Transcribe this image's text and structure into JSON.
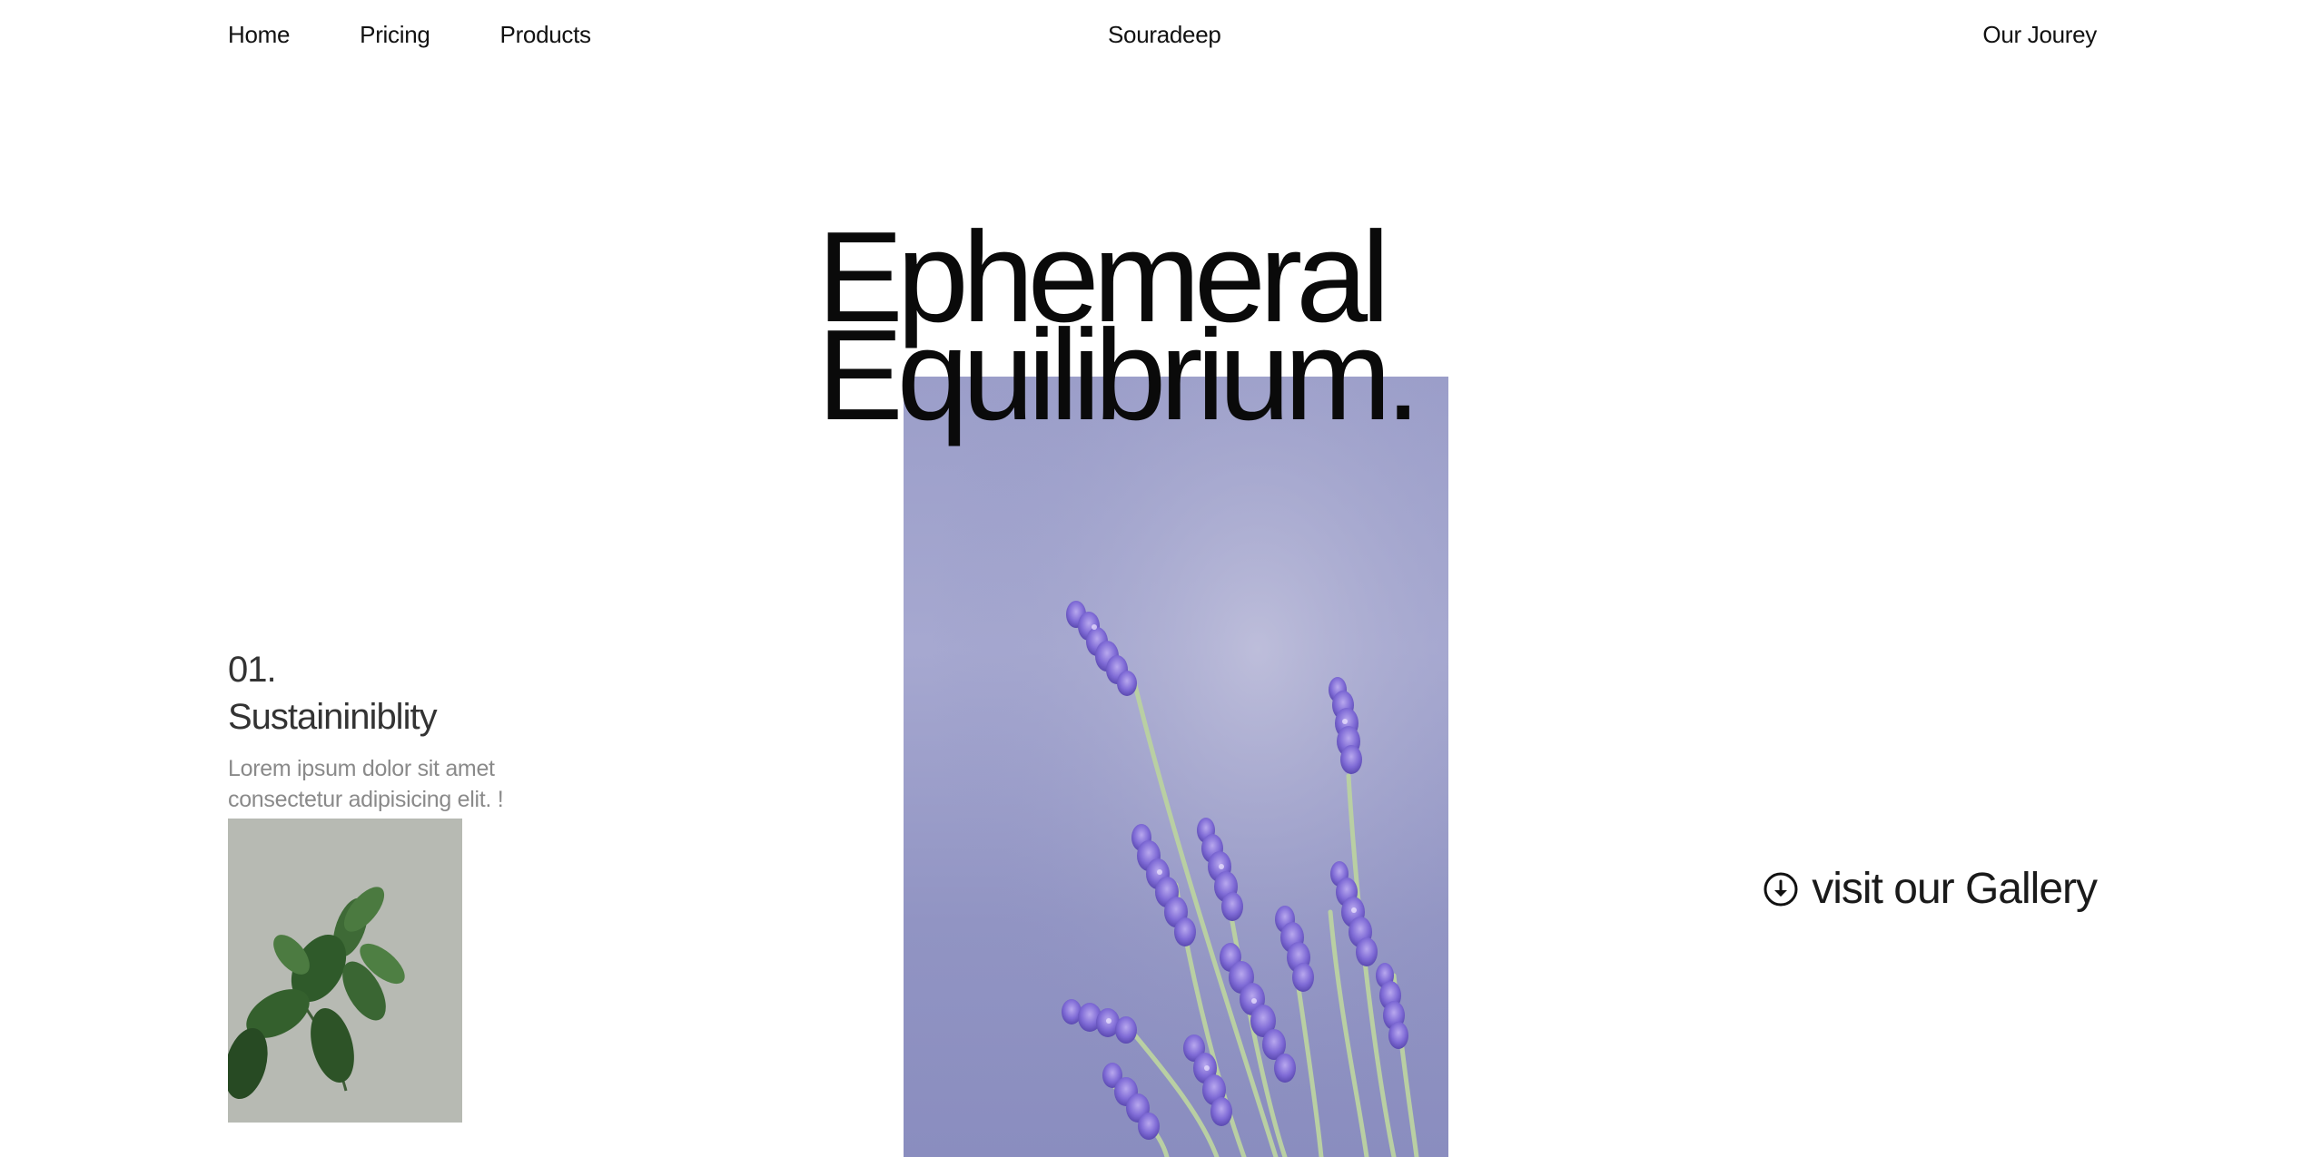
{
  "nav": {
    "items": [
      {
        "label": "Home"
      },
      {
        "label": "Pricing"
      },
      {
        "label": "Products"
      }
    ],
    "brand": "Souradeep",
    "right_link": "Our Jourey"
  },
  "hero": {
    "title_line1": "Ephemeral",
    "title_line2": "Equilibrium.",
    "image": "lavender-photo"
  },
  "feature": {
    "number": "01.",
    "title": "Sustaininiblity",
    "description": "Lorem ipsum dolor sit amet consectetur adipisicing elit. !",
    "image": "rubber-plant-photo"
  },
  "gallery": {
    "label": "visit our Gallery",
    "icon": "arrow-down-circle-icon"
  },
  "colors": {
    "background": "#ffffff",
    "text": "#111111",
    "muted_text": "#8a8a8a",
    "lavender_bg": "#9b9ec9",
    "plant_bg": "#b8bbb4"
  }
}
